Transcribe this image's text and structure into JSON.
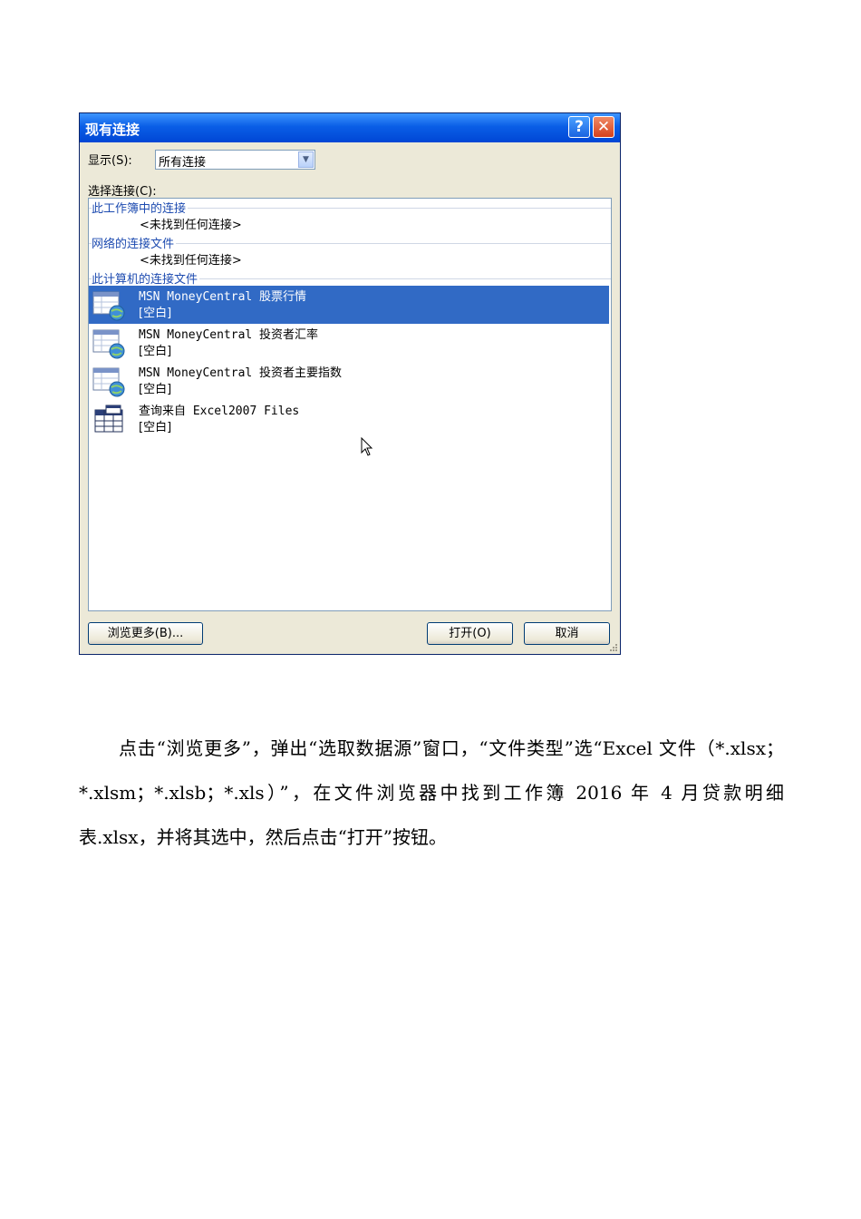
{
  "dialog": {
    "title": "现有连接",
    "help_glyph": "?",
    "close_glyph": "✕",
    "show_label": "显示(S):",
    "show_value": "所有连接",
    "choose_label": "选择连接(C):",
    "groups": [
      {
        "header": "此工作簿中的连接",
        "empty_note": "<未找到任何连接>"
      },
      {
        "header": "网络的连接文件",
        "empty_note": "<未找到任何连接>"
      },
      {
        "header": "此计算机的连接文件"
      }
    ],
    "items": [
      {
        "name": "MSN MoneyCentral 股票行情",
        "desc": "[空白]",
        "icon": "web-connection-icon",
        "selected": true
      },
      {
        "name": "MSN MoneyCentral 投资者汇率",
        "desc": "[空白]",
        "icon": "web-connection-icon",
        "selected": false
      },
      {
        "name": "MSN MoneyCentral 投资者主要指数",
        "desc": "[空白]",
        "icon": "web-connection-icon",
        "selected": false
      },
      {
        "name": "查询来自 Excel2007 Files",
        "desc": "[空白]",
        "icon": "table-query-icon",
        "selected": false
      }
    ],
    "buttons": {
      "browse": "浏览更多(B)...",
      "open": "打开(O)",
      "cancel": "取消"
    },
    "colors": {
      "titlebar": "#0a5ee6",
      "selection": "#316ac5",
      "group_header": "#1d4bb0"
    }
  },
  "paragraph": "点击“浏览更多”，弹出“选取数据源”窗口，“文件类型”选“Excel 文件（*.xlsx；*.xlsm；*.xlsb；*.xls）”，在文件浏览器中找到工作簿 2016 年 4 月贷款明细表.xlsx，并将其选中，然后点击“打开”按钮。"
}
